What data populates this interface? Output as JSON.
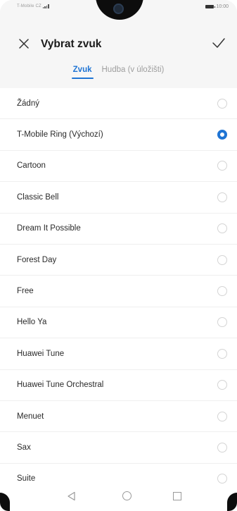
{
  "status_bar": {
    "carrier": "T-Mobile CZ",
    "time": "10:00"
  },
  "header": {
    "title": "Vybrat zvuk",
    "close_icon": "close-icon",
    "confirm_icon": "checkmark-icon"
  },
  "tabs": [
    {
      "label": "Zvuk",
      "active": true
    },
    {
      "label": "Hudba (v úložišti)",
      "active": false
    }
  ],
  "ringtones": [
    {
      "label": "Žádný",
      "selected": false
    },
    {
      "label": "T-Mobile Ring (Výchozí)",
      "selected": true
    },
    {
      "label": "Cartoon",
      "selected": false
    },
    {
      "label": "Classic Bell",
      "selected": false
    },
    {
      "label": "Dream It Possible",
      "selected": false
    },
    {
      "label": "Forest Day",
      "selected": false
    },
    {
      "label": "Free",
      "selected": false
    },
    {
      "label": "Hello Ya",
      "selected": false
    },
    {
      "label": "Huawei Tune",
      "selected": false
    },
    {
      "label": "Huawei Tune Orchestral",
      "selected": false
    },
    {
      "label": "Menuet",
      "selected": false
    },
    {
      "label": "Sax",
      "selected": false
    },
    {
      "label": "Suite",
      "selected": false
    }
  ],
  "nav_bar": {
    "back_icon": "triangle-back-icon",
    "home_icon": "circle-home-icon",
    "recent_icon": "square-recent-icon"
  },
  "colors": {
    "accent": "#1f74d4",
    "text": "#1a1a1a",
    "muted": "#9e9e9e"
  }
}
